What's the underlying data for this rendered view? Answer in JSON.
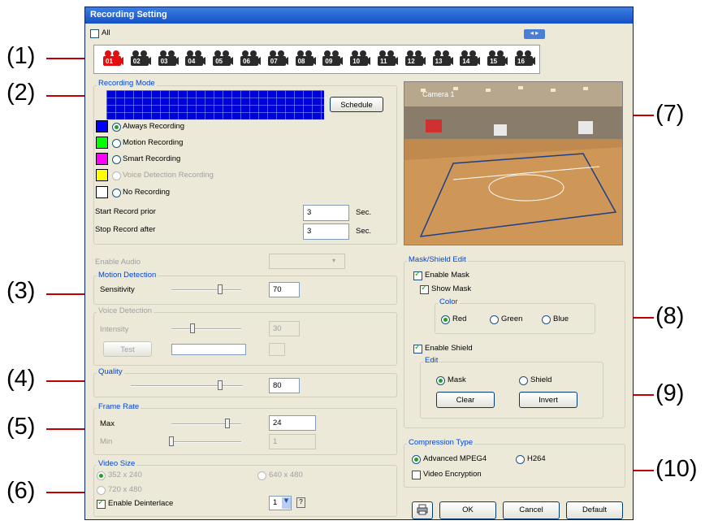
{
  "callouts": [
    "(1)",
    "(2)",
    "(3)",
    "(4)",
    "(5)",
    "(6)",
    "(7)",
    "(8)",
    "(9)",
    "(10)"
  ],
  "window": {
    "title": "Recording Setting"
  },
  "top": {
    "all_label": "All",
    "nav_arrows": "◂ ▸"
  },
  "cameras": [
    "01",
    "02",
    "03",
    "04",
    "05",
    "06",
    "07",
    "08",
    "09",
    "10",
    "11",
    "12",
    "13",
    "14",
    "15",
    "16"
  ],
  "recording_mode": {
    "label": "Recording Mode",
    "schedule_button": "Schedule",
    "options": [
      {
        "label": "Always Recording",
        "color": "#0000ff",
        "selected": true,
        "enabled": true
      },
      {
        "label": "Motion Recording",
        "color": "#00ff00",
        "selected": false,
        "enabled": true
      },
      {
        "label": "Smart Recording",
        "color": "#ff00ff",
        "selected": false,
        "enabled": true
      },
      {
        "label": "Voice Detection Recording",
        "color": "#ffff00",
        "selected": false,
        "enabled": false
      },
      {
        "label": "No Recording",
        "color": "#ffffff",
        "selected": false,
        "enabled": true
      }
    ],
    "start_prior_label": "Start Record prior",
    "start_prior_value": "3",
    "stop_after_label": "Stop Record after",
    "stop_after_value": "3",
    "sec_unit": "Sec."
  },
  "audio": {
    "label": "Enable Audio"
  },
  "motion_detection": {
    "label": "Motion Detection",
    "sensitivity_label": "Sensitivity",
    "value": "70",
    "level": 70
  },
  "voice_detection": {
    "label": "Voice Detection",
    "intensity_label": "Intensity",
    "value": "30",
    "level": 30,
    "test_button": "Test"
  },
  "quality": {
    "label": "Quality",
    "value": "80",
    "level": 80
  },
  "frame_rate": {
    "label": "Frame Rate",
    "max_label": "Max",
    "max_value": "24",
    "max_level": 80,
    "min_label": "Min",
    "min_value": "1",
    "min_level": 0
  },
  "video_size": {
    "label": "Video Size",
    "opt1": "352 x 240",
    "opt2": "640 x 480",
    "opt3": "720 x 480",
    "deinterlace_label": "Enable Deinterlace",
    "deinterlace_value": "1",
    "help": "?"
  },
  "preview": {
    "camera_label": "Camera 1"
  },
  "mask_shield": {
    "label": "Mask/Shield Edit",
    "enable_mask": "Enable Mask",
    "show_mask": "Show Mask",
    "color_label": "Color",
    "red": "Red",
    "green": "Green",
    "blue": "Blue",
    "enable_shield": "Enable Shield",
    "edit_label": "Edit",
    "mask": "Mask",
    "shield": "Shield",
    "clear_button": "Clear",
    "invert_button": "Invert"
  },
  "compression": {
    "label": "Compression Type",
    "opt1": "Advanced MPEG4",
    "opt2": "H264",
    "encryption": "Video Encryption"
  },
  "footer": {
    "ok": "OK",
    "cancel": "Cancel",
    "default": "Default"
  }
}
